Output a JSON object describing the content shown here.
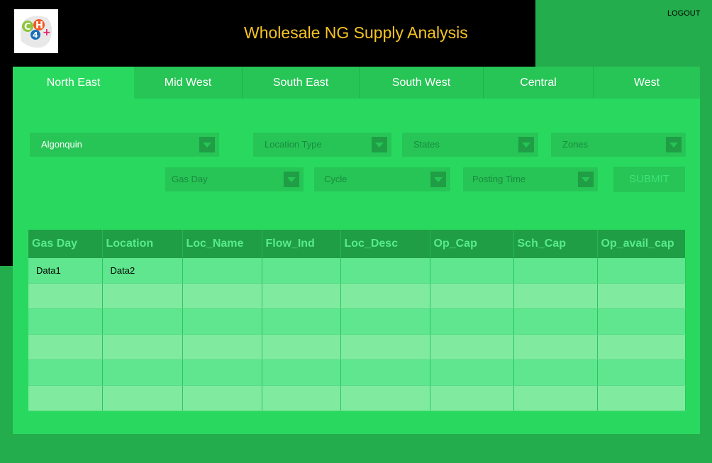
{
  "header": {
    "logo_icon": "ch4-molecule-logo-icon",
    "title": "Wholesale NG Supply Analysis",
    "logout": "LOGOUT"
  },
  "tabs": [
    {
      "label": "North East",
      "active": true
    },
    {
      "label": "Mid West"
    },
    {
      "label": "South East"
    },
    {
      "label": "South West"
    },
    {
      "label": "Central"
    },
    {
      "label": "West"
    }
  ],
  "filters": {
    "pipeline": "Algonquin",
    "location_type": "Location Type",
    "states": "States",
    "zones": "Zones",
    "gas_day": "Gas Day",
    "cycle": "Cycle",
    "posting_time": "Posting Time",
    "submit": "SUBMIT"
  },
  "table": {
    "columns": [
      "Gas Day",
      "Location",
      "Loc_Name",
      "Flow_Ind",
      "Loc_Desc",
      "Op_Cap",
      "Sch_Cap",
      "Op_avail_cap"
    ],
    "rows": [
      [
        "Data1",
        "Data2",
        "",
        "",
        "",
        "",
        "",
        ""
      ],
      [
        "",
        "",
        "",
        "",
        "",
        "",
        "",
        ""
      ],
      [
        "",
        "",
        "",
        "",
        "",
        "",
        "",
        ""
      ],
      [
        "",
        "",
        "",
        "",
        "",
        "",
        "",
        ""
      ],
      [
        "",
        "",
        "",
        "",
        "",
        "",
        "",
        ""
      ],
      [
        "",
        "",
        "",
        "",
        "",
        "",
        "",
        ""
      ]
    ]
  },
  "colors": {
    "accent_title": "#f6c422",
    "panel": "#29d95f",
    "background": "#24ad4d"
  }
}
